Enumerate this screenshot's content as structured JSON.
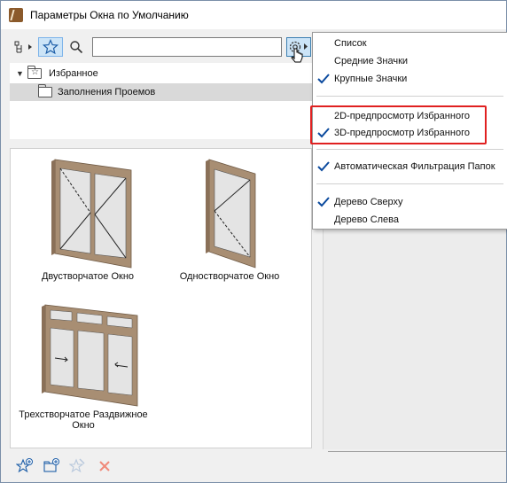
{
  "window": {
    "title": "Параметры Окна по Умолчанию"
  },
  "toolbar": {
    "search": {
      "value": "",
      "placeholder": ""
    },
    "icons": [
      "tree-view-icon",
      "favorites-star-icon",
      "search-icon",
      "settings-gear-icon"
    ]
  },
  "tree": {
    "items": [
      {
        "label": "Избранное",
        "expanded": true
      },
      {
        "label": "Заполнения Проемов",
        "selected": true
      }
    ]
  },
  "previews": [
    {
      "label": "Двустворчатое Окно"
    },
    {
      "label": "Одностворчатое Окно"
    },
    {
      "label": "Трехстворчатое Раздвижное Окно"
    }
  ],
  "menu": {
    "items": [
      {
        "label": "Список",
        "checked": false
      },
      {
        "label": "Средние Значки",
        "checked": false
      },
      {
        "label": "Крупные Значки",
        "checked": true
      },
      {
        "label": "2D-предпросмотр Избранного",
        "checked": false
      },
      {
        "label": "3D-предпросмотр Избранного",
        "checked": true
      },
      {
        "label": "Автоматическая Фильтрация Папок",
        "checked": true
      },
      {
        "label": "Дерево Сверху",
        "checked": true
      },
      {
        "label": "Дерево Слева",
        "checked": false
      }
    ]
  },
  "bottom_bar": {
    "icons": [
      "add-favorite-icon",
      "new-folder-icon",
      "edit-favorite-icon",
      "delete-icon"
    ]
  },
  "colors": {
    "accent": "#0078d7",
    "selection": "#cce4f7",
    "highlight_border": "#e02020",
    "frame_wood": "#a88e73"
  }
}
